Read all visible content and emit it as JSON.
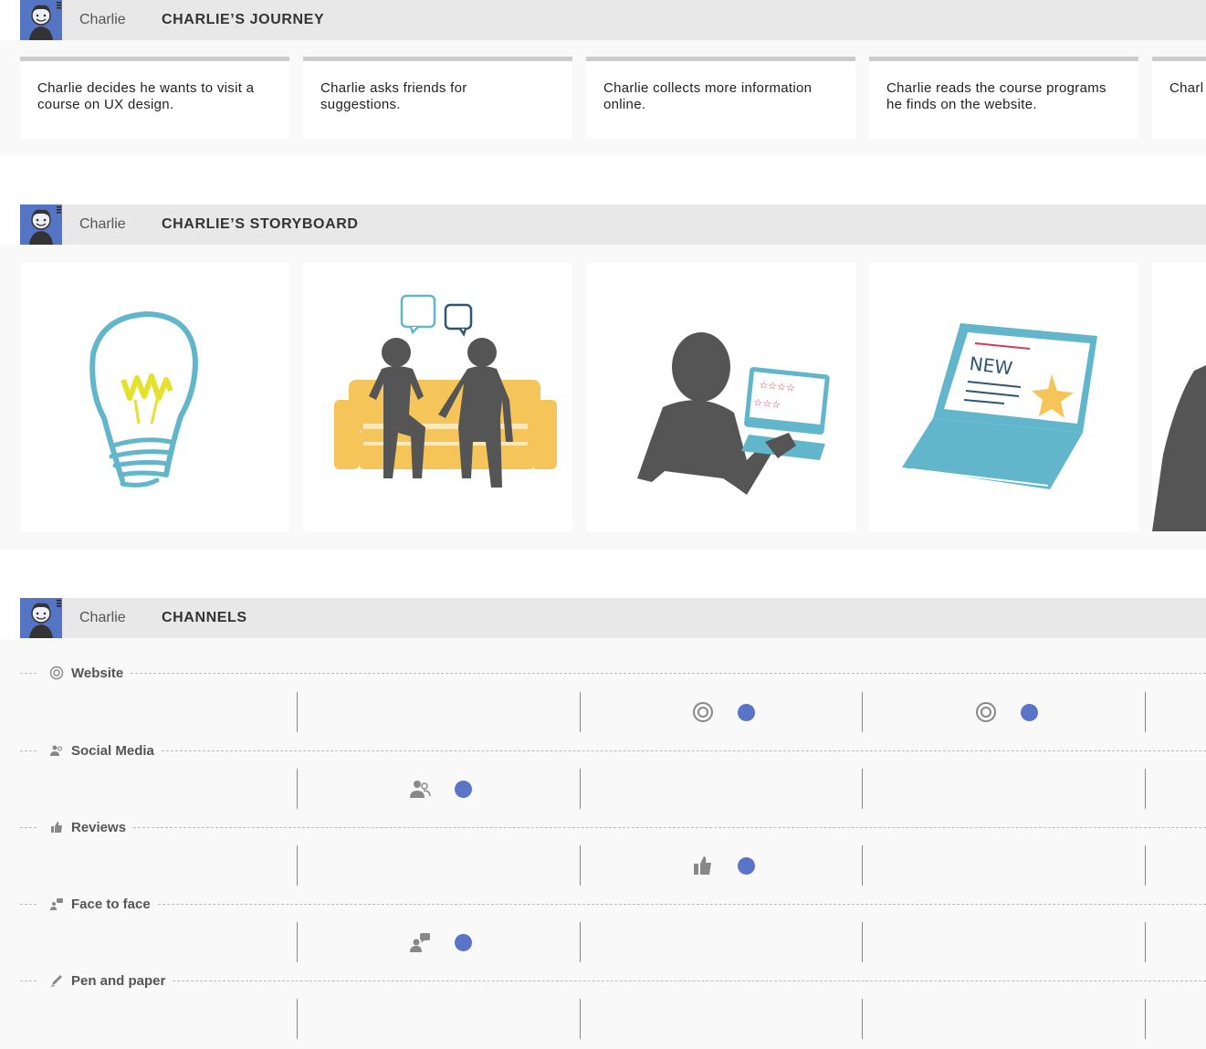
{
  "persona": {
    "name": "Charlie"
  },
  "journey": {
    "title": "CHARLIE’S JOURNEY",
    "steps": [
      "Charlie decides he wants to visit a\ncourse on UX design.",
      "Charlie asks friends for\nsuggestions.",
      "Charlie collects more information\nonline.",
      "Charlie reads the course programs\nhe finds on the website.",
      "Charl"
    ]
  },
  "storyboard": {
    "title": "CHARLIE’S STORYBOARD",
    "frames": [
      "lightbulb-idea",
      "friends-on-sofa",
      "person-with-laptop-reviews",
      "laptop-new-course"
    ]
  },
  "channels": {
    "title": "CHANNELS",
    "rows": [
      {
        "name": "Website",
        "icon": "target-icon",
        "active": [
          false,
          true,
          true
        ]
      },
      {
        "name": "Social Media",
        "icon": "people-icon",
        "active": [
          true,
          false,
          false
        ]
      },
      {
        "name": "Reviews",
        "icon": "thumbs-up-icon",
        "active": [
          false,
          true,
          false
        ]
      },
      {
        "name": "Face to face",
        "icon": "conversation-icon",
        "active": [
          true,
          false,
          false
        ]
      },
      {
        "name": "Pen and paper",
        "icon": "pen-icon",
        "active": [
          false,
          false,
          false
        ]
      }
    ]
  },
  "colors": {
    "accent": "#5a74c8",
    "header_bg": "#e8e8e8",
    "avatar_bg": "#5674c4"
  }
}
